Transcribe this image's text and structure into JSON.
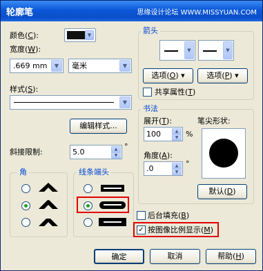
{
  "title": "轮廓笔",
  "watermark": "思缘设计论坛 WWW.MISSYUAN.COM",
  "color": {
    "label": "颜色(",
    "key": "C",
    "suffix": "):",
    "value": "#111111"
  },
  "width": {
    "label": "宽度(",
    "key": "W",
    "suffix": "):",
    "value": ".669 mm",
    "unit": "毫米"
  },
  "style": {
    "label": "样式(",
    "key": "S",
    "suffix": "):"
  },
  "edit_style_button": "编辑样式...",
  "miter": {
    "label": "斜接限制:",
    "value": "5.0",
    "unit": "°"
  },
  "corner_group": {
    "label": "角",
    "selected": 1
  },
  "linecap_group": {
    "label": "线条端头",
    "selected": 1
  },
  "arrows": {
    "label": "箭头",
    "options_left": {
      "label": "选项(",
      "key": "O",
      "suffix": ")"
    },
    "options_right": {
      "label": "选项(",
      "key": "P",
      "suffix": ")"
    },
    "share": {
      "label": "共享属性(",
      "key": "T",
      "suffix": ")"
    }
  },
  "calligraphy": {
    "label": "书法",
    "stretch": {
      "label": "展开(",
      "key": "T",
      "suffix": "):",
      "value": "100",
      "unit": "%"
    },
    "nib_shape_label": "笔尖形状:",
    "angle": {
      "label": "角度(",
      "key": "A",
      "suffix": "):",
      "value": ".0",
      "unit": "°"
    },
    "default_button": {
      "label": "默认(",
      "key": "D",
      "suffix": ")"
    }
  },
  "behind_fill": {
    "label": "后台填充(",
    "key": "B",
    "suffix": ")",
    "checked": false
  },
  "scale_with_image": {
    "label": "按图像比例显示(",
    "key": "M",
    "suffix": ")",
    "checked": true
  },
  "buttons": {
    "ok": "确定",
    "cancel_label": "取消",
    "help": {
      "label": "帮助(",
      "key": "H",
      "suffix": ")"
    }
  }
}
